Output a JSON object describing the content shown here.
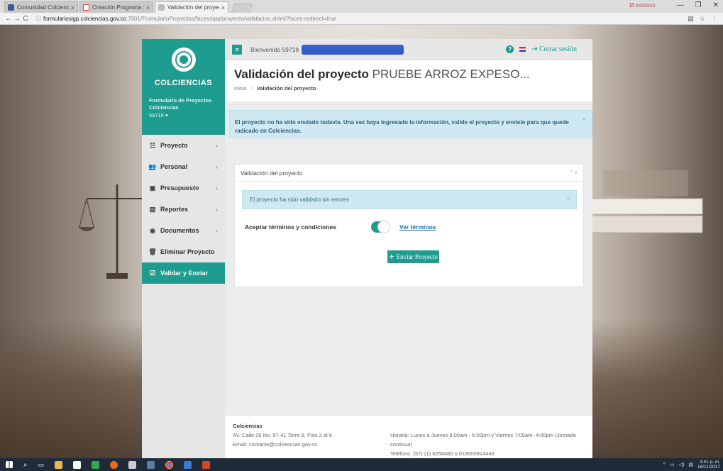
{
  "browser": {
    "tabs": [
      {
        "title": "Comunidad Colciencias",
        "color": "#3b5998"
      },
      {
        "title": "Creación Programa : PRI",
        "color": "#d44"
      },
      {
        "title": "Validación del proyecto",
        "color": "#888"
      }
    ],
    "profile": "Ø xxxxxxx",
    "url_host": "formulariosigp.colciencias.gov.co",
    "url_path": ":7001/FormularioProyectos/faces/app/proyecto/validacion.xhtml?faces-redirect=true"
  },
  "sidebar": {
    "brand": "COLCIENCIAS",
    "subtitle": "Formulario de Proyectos Colciencias",
    "user": "59718 ▾",
    "items": [
      {
        "label": "Proyecto",
        "icon": "☷",
        "chevron": "‹"
      },
      {
        "label": "Personal",
        "icon": "👥",
        "chevron": "‹"
      },
      {
        "label": "Presupuesto",
        "icon": "▣",
        "chevron": "‹"
      },
      {
        "label": "Reportes",
        "icon": "▤",
        "chevron": "‹"
      },
      {
        "label": "Documentos",
        "icon": "◉",
        "chevron": "‹"
      },
      {
        "label": "Eliminar Proyecto",
        "icon": "🗑",
        "chevron": ""
      },
      {
        "label": "Validar y Enviar",
        "icon": "☑",
        "chevron": ""
      }
    ]
  },
  "topbar": {
    "welcome": "Bienvenido 59718",
    "logout": "Cerrar sesión"
  },
  "header": {
    "title": "Validación del proyecto",
    "project": "PRUEBE ARROZ EXPESO...",
    "breadcrumb_home": "Inicio",
    "breadcrumb_sep": "/",
    "breadcrumb_current": "Validación del proyecto"
  },
  "notice": {
    "text": "El proyecto no ha sido enviado todavía. Una vez haya ingresado la información, valide el proyecto y envíelo para que quede radicado en Colciencias.",
    "close": "×"
  },
  "validation_card": {
    "title": "Validación del proyecto",
    "tools": "^ ×",
    "status": "El proyecto ha sido validado sin errores",
    "status_close": "×",
    "terms_label": "Aceptar términos y condiciones",
    "terms_accepted": true,
    "terms_link": "Ver términos",
    "send_button": "Enviar Proyecto"
  },
  "footer": {
    "org": "Colciencias",
    "address": "AV. Calle 26 No. 57-41 Torre 8, Piso 2 al 6",
    "email": "Email: contacto@colciencias.gov.co",
    "hours": "Horario: Lunes a Jueves 8:00am - 5:00pm y Viernes 7:00am- 4:00pm (Jornada continua)",
    "phone": "Teléfono: (57) (1) 6258480 o 018000914446"
  },
  "taskbar": {
    "time": "3:41 p. m.",
    "date": "16/11/2017"
  }
}
